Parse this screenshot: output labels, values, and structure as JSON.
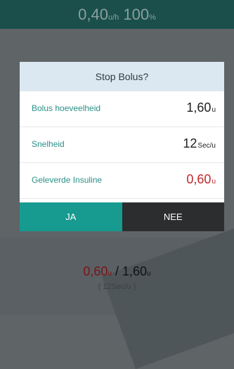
{
  "header": {
    "basal_value": "0,40",
    "basal_unit": "u/h",
    "percent_value": "100",
    "percent_unit": "%"
  },
  "dialog": {
    "title": "Stop Bolus?",
    "rows": [
      {
        "label": "Bolus hoeveelheid",
        "value": "1,60",
        "unit": "u"
      },
      {
        "label": "Snelheid",
        "value": "12",
        "unit": "Sec/u"
      },
      {
        "label": "Geleverde Insuline",
        "value": "0,60",
        "unit": "u"
      }
    ],
    "yes_label": "JA",
    "no_label": "NEE"
  },
  "delivery": {
    "delivered": "0,60",
    "delivered_unit": "u",
    "separator": " / ",
    "total": "1,60",
    "total_unit": "u",
    "rate_open": "( ",
    "rate_value": "12",
    "rate_unit": "Sec/u",
    "rate_close": " )"
  },
  "colors": {
    "accent": "#179a90",
    "header_bg": "#1a4f4b",
    "alert_red": "#c1272d",
    "dialog_title_bg": "#dce8f1"
  }
}
